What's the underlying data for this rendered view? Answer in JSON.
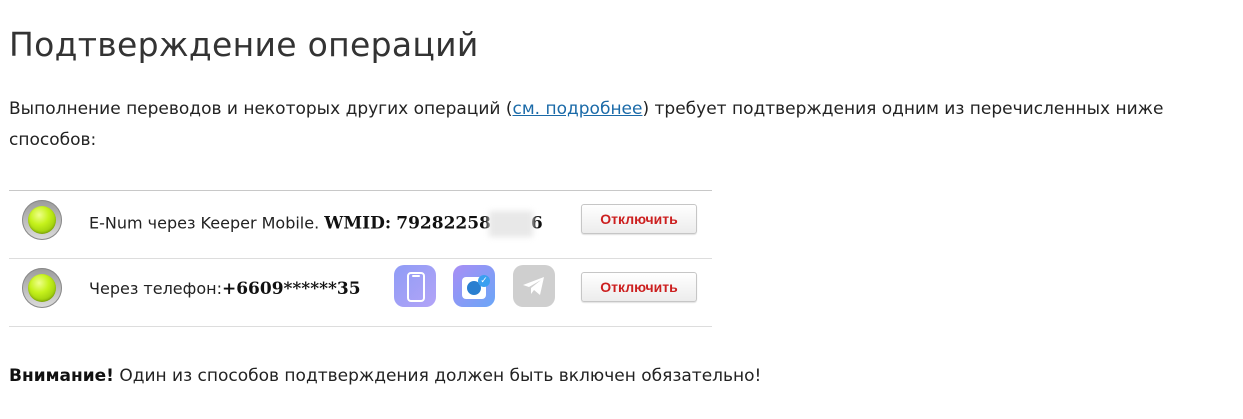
{
  "page": {
    "title": "Подтверждение операций",
    "intro": {
      "before_link": "Выполнение переводов и некоторых других операций (",
      "link_text": "см. подробнее",
      "after_link": ") требует подтверждения одним из перечисленных ниже способов:"
    }
  },
  "methods": [
    {
      "status": "enabled",
      "label": "E-Num через Keeper Mobile.",
      "value_label": "WMID:",
      "value_start": "79282258",
      "value_end": "6",
      "button_label": "Отключить"
    },
    {
      "status": "enabled",
      "label": "Через телефон:",
      "value": "+6609******35",
      "icons": [
        "phone-app-icon",
        "keeper-app-icon",
        "telegram-icon"
      ],
      "button_label": "Отключить"
    }
  ],
  "warning": {
    "bold": "Внимание!",
    "text": " Один из способов подтверждения должен быть включен обязательно!"
  },
  "colors": {
    "link": "#1a6aa8",
    "button_text": "#cc1f1f",
    "led_on": "#c6f21c"
  }
}
